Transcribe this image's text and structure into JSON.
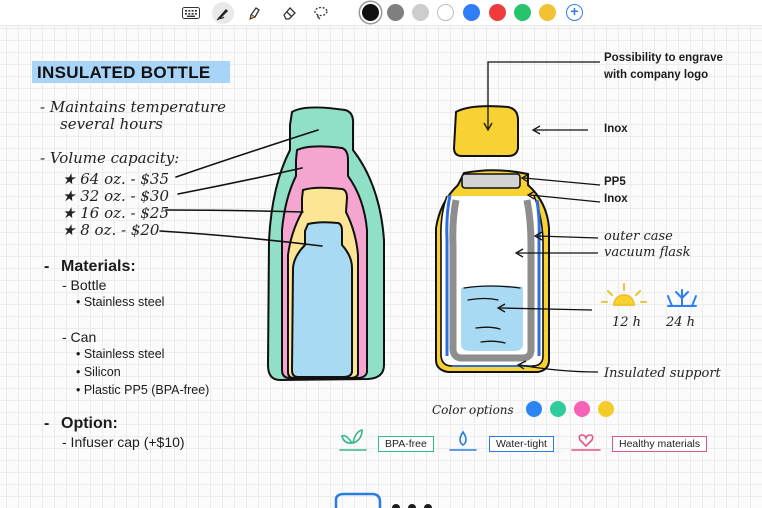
{
  "toolbar": {
    "tools": [
      "keyboard-icon",
      "pen-icon",
      "highlighter-icon",
      "eraser-icon",
      "lasso-icon"
    ],
    "colors": [
      "#111111",
      "#7f7f7f",
      "#cdcdcd",
      "#ffffff",
      "#2f7ef6",
      "#ef3b3b",
      "#27c46b",
      "#f1c232"
    ],
    "selected_color": "#111111",
    "add_color_symbol": "+"
  },
  "note": {
    "title": "INSULATED BOTTLE",
    "lines": {
      "maintains_1": "- Maintains temperature",
      "maintains_2": "several hours",
      "volume": "- Volume capacity:",
      "size_64": "★ 64 oz. - $35",
      "size_32": "★ 32 oz. - $30",
      "size_16": "★ 16 oz. - $25",
      "size_8": "★ 8 oz. - $20"
    },
    "materials": {
      "heading": "Materials:",
      "bottle_label": "- Bottle",
      "bottle_items": [
        "• Stainless steel"
      ],
      "can_label": "- Can",
      "can_items": [
        "• Stainless steel",
        "• Silicon",
        "• Plastic PP5 (BPA-free)"
      ]
    },
    "option": {
      "heading": "Option:",
      "item": "- Infuser cap (+$10)"
    }
  },
  "diagram": {
    "labels": {
      "engrave_1": "Possibility to engrave",
      "engrave_2": "with company logo",
      "inox_top": "Inox",
      "pp5": "PP5",
      "inox_mid": "Inox",
      "outer_case": "outer case",
      "vacuum_flask": "vacuum flask",
      "hours_12": "12 h",
      "hours_24": "24 h",
      "insulated_support": "Insulated support",
      "color_options": "Color options"
    },
    "color_options": [
      "#2b86f2",
      "#2fcc9b",
      "#f562b6",
      "#f4cc2a"
    ],
    "badges": [
      {
        "label": "BPA-free",
        "color": "#35b88a"
      },
      {
        "label": "Water-tight",
        "color": "#2a7de0"
      },
      {
        "label": "Healthy materials",
        "color": "#e2558a"
      }
    ],
    "bottle_colors": {
      "size_64": "#8fe0c6",
      "size_32": "#f4a6d1",
      "size_16": "#fde596",
      "size_8": "#a9daf4"
    }
  }
}
